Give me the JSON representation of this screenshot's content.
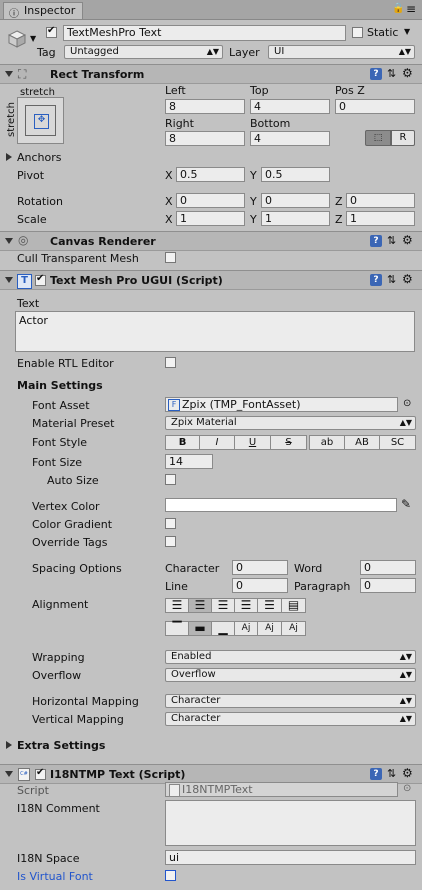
{
  "tab": {
    "label": "Inspector"
  },
  "object": {
    "name": "TextMeshPro Text",
    "static_label": "Static",
    "tag_label": "Tag",
    "tag_value": "Untagged",
    "layer_label": "Layer",
    "layer_value": "UI"
  },
  "rect": {
    "title": "Rect Transform",
    "stretch_top": "stretch",
    "stretch_side": "stretch",
    "left_label": "Left",
    "left_value": "8",
    "top_label": "Top",
    "top_value": "4",
    "posz_label": "Pos Z",
    "posz_value": "0",
    "right_label": "Right",
    "right_value": "8",
    "bottom_label": "Bottom",
    "bottom_value": "4",
    "r_button": "R",
    "anchors_label": "Anchors",
    "pivot_label": "Pivot",
    "pivot_x": "0.5",
    "pivot_y": "0.5",
    "rotation_label": "Rotation",
    "rot_x": "0",
    "rot_y": "0",
    "rot_z": "0",
    "scale_label": "Scale",
    "scale_x": "1",
    "scale_y": "1",
    "scale_z": "1",
    "x": "X",
    "y": "Y",
    "z": "Z"
  },
  "canvas": {
    "title": "Canvas Renderer",
    "cull_label": "Cull Transparent Mesh"
  },
  "tmp": {
    "title": "Text Mesh Pro UGUI (Script)",
    "text_label": "Text",
    "text_value": "Actor",
    "rtl_label": "Enable RTL Editor",
    "main_settings": "Main Settings",
    "font_asset_label": "Font Asset",
    "font_asset_value": "Zpix (TMP_FontAsset)",
    "material_label": "Material Preset",
    "material_value": "Zpix Material",
    "font_style_label": "Font Style",
    "styles": [
      "B",
      "I",
      "U",
      "S",
      "ab",
      "AB",
      "SC"
    ],
    "font_size_label": "Font Size",
    "font_size_value": "14",
    "auto_size_label": "Auto Size",
    "vertex_color_label": "Vertex Color",
    "gradient_label": "Color Gradient",
    "override_label": "Override Tags",
    "spacing_label": "Spacing Options",
    "character_label": "Character",
    "character_value": "0",
    "word_label": "Word",
    "word_value": "0",
    "line_label": "Line",
    "line_value": "0",
    "paragraph_label": "Paragraph",
    "paragraph_value": "0",
    "alignment_label": "Alignment",
    "wrapping_label": "Wrapping",
    "wrapping_value": "Enabled",
    "overflow_label": "Overflow",
    "overflow_value": "Overflow",
    "hmap_label": "Horizontal Mapping",
    "hmap_value": "Character",
    "vmap_label": "Vertical Mapping",
    "vmap_value": "Character",
    "extra_label": "Extra Settings"
  },
  "i18n": {
    "title": "I18NTMP Text (Script)",
    "script_label": "Script",
    "script_value": "I18NTMPText",
    "comment_label": "I18N Comment",
    "space_label": "I18N Space",
    "space_value": "ui",
    "virtual_label": "Is Virtual Font"
  },
  "colors": {
    "accent": "#3b66b5",
    "virtual_font_label": "#2255cc",
    "header": "#b6b6b6",
    "background": "#c2c2c2"
  }
}
